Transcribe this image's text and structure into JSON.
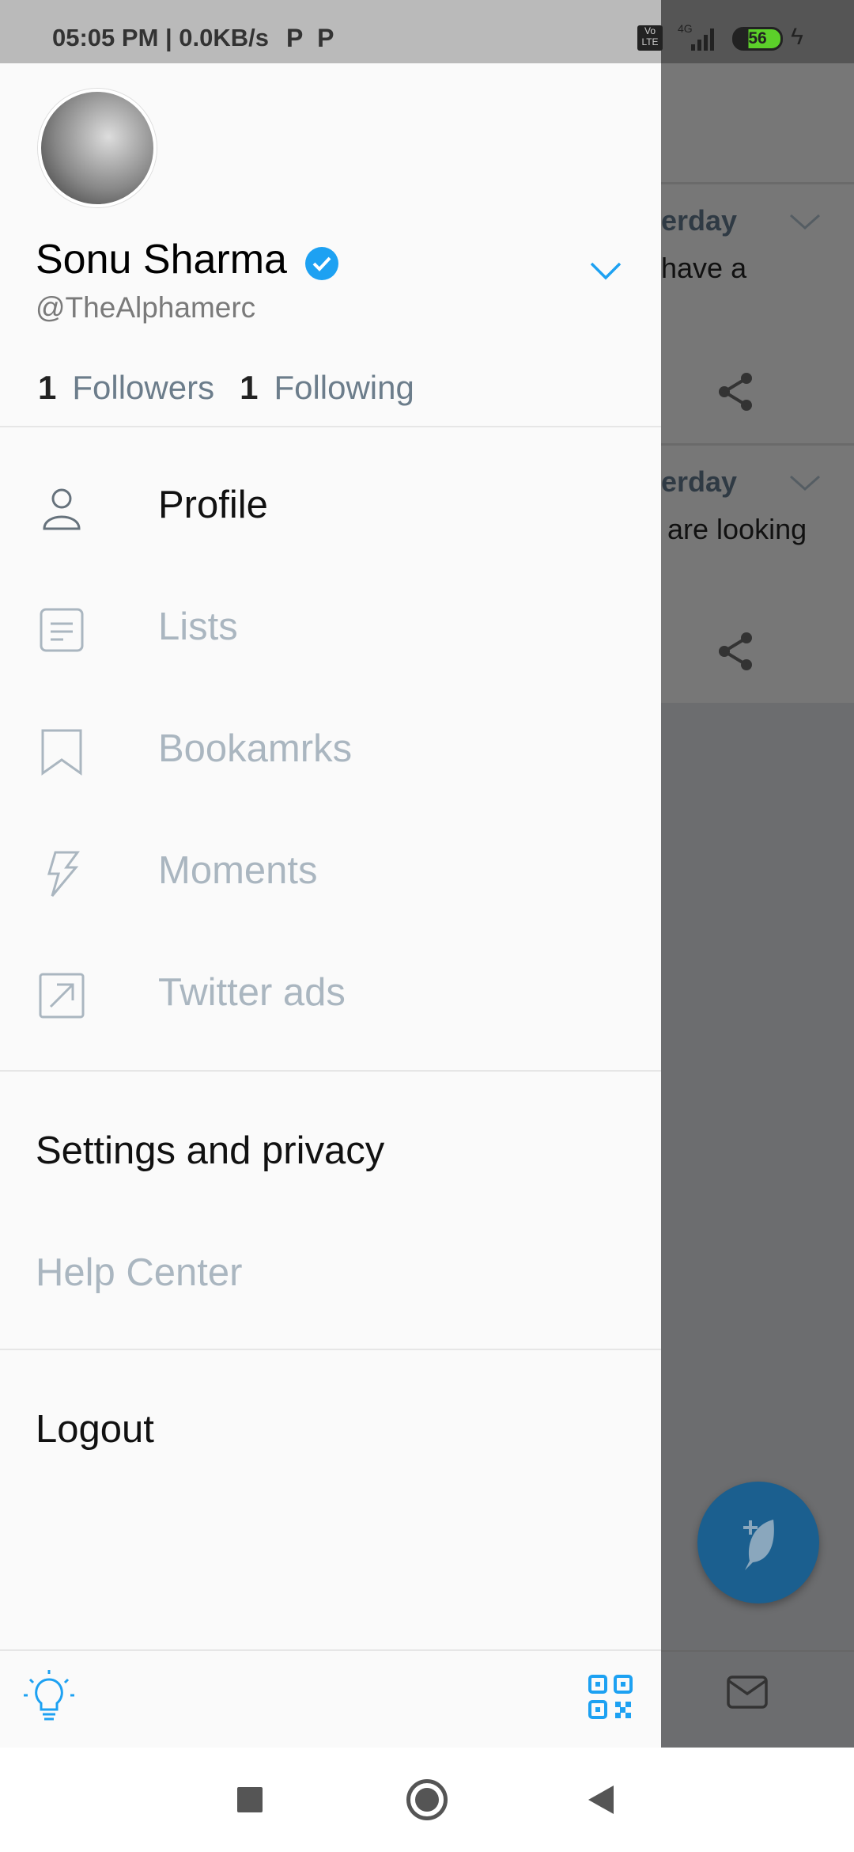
{
  "status_bar": {
    "time": "05:05 PM | 0.0KB/s",
    "battery": "56",
    "network": "4G"
  },
  "profile": {
    "name": "Sonu Sharma",
    "handle": "@TheAlphamerc",
    "followers_count": "1",
    "followers_label": "Followers",
    "following_count": "1",
    "following_label": "Following",
    "verified": true
  },
  "menu": [
    {
      "label": "Profile",
      "icon": "person-icon",
      "active": true
    },
    {
      "label": "Lists",
      "icon": "list-icon",
      "active": false
    },
    {
      "label": "Bookamrks",
      "icon": "bookmark-icon",
      "active": false
    },
    {
      "label": "Moments",
      "icon": "lightning-icon",
      "active": false
    },
    {
      "label": "Twitter ads",
      "icon": "external-link-icon",
      "active": false
    }
  ],
  "secondary": [
    {
      "label": "Settings and privacy",
      "active": true
    },
    {
      "label": "Help Center",
      "active": false
    }
  ],
  "logout": "Logout",
  "background": {
    "tweet1_day": "erday",
    "tweet1_text": "have a",
    "tweet2_day": "erday",
    "tweet2_text": "are looking"
  },
  "colors": {
    "accent": "#1da1f2",
    "fab": "#1b5f8f"
  }
}
